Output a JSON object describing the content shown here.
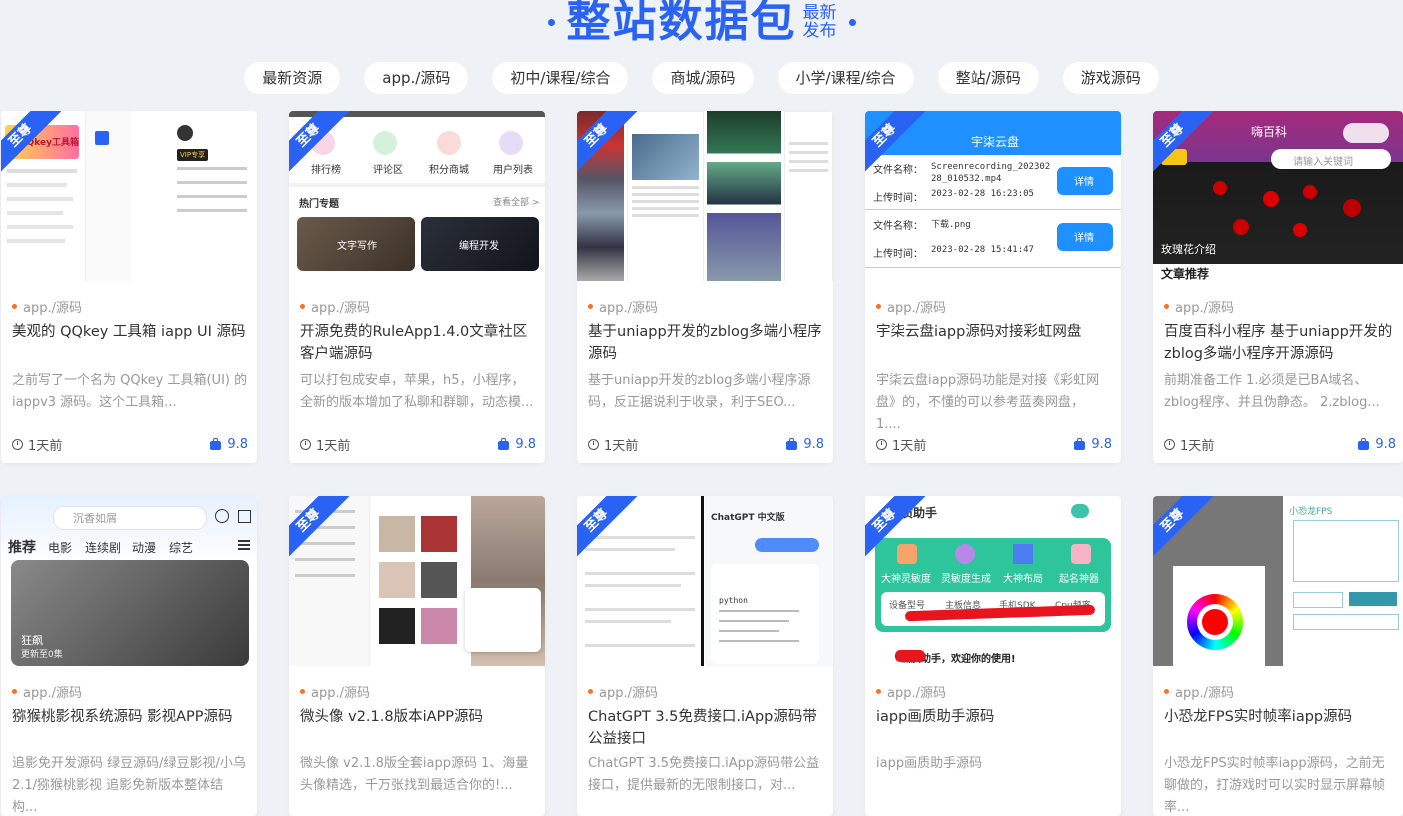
{
  "header": {
    "title": "整站数据包",
    "subtitle_1": "最新",
    "subtitle_2": "发布",
    "accent": "#2a63f3"
  },
  "tabs": [
    "最新资源",
    "app./源码",
    "初中/课程/综合",
    "商城/源码",
    "小学/课程/综合",
    "整站/源码",
    "游戏源码"
  ],
  "badge_label": "至尊",
  "cards": [
    {
      "category": "app./源码",
      "title": "美观的 QQkey 工具箱 iapp UI 源码",
      "desc": "之前写了一个名为 QQkey 工具箱(UI) 的 iappv3 源码。这个工具箱...",
      "time": "1天前",
      "score": "9.8"
    },
    {
      "category": "app./源码",
      "title": "开源免费的RuleApp1.4.0文章社区客户端源码",
      "desc": "可以打包成安卓，苹果，h5，小程序，全新的版本增加了私聊和群聊，动态模...",
      "time": "1天前",
      "score": "9.8"
    },
    {
      "category": "app./源码",
      "title": "基于uniapp开发的zblog多端小程序源码",
      "desc": "基于uniapp开发的zblog多端小程序源码，反正据说利于收录，利于SEO...",
      "time": "1天前",
      "score": "9.8"
    },
    {
      "category": "app./源码",
      "title": "宇柒云盘iapp源码对接彩虹网盘",
      "desc": "宇柒云盘iapp源码功能是对接《彩虹网盘》的，不懂的可以参考蓝奏网盘， 1....",
      "time": "1天前",
      "score": "9.8"
    },
    {
      "category": "app./源码",
      "title": "百度百科小程序 基于uniapp开发的zblog多端小程序开源源码",
      "desc": "前期准备工作 1.必须是已BA域名、zblog程序、并且伪静态。 2.zblog...",
      "time": "1天前",
      "score": "9.8"
    },
    {
      "category": "app./源码",
      "title": "猕猴桃影视系统源码 影视APP源码",
      "desc": "追影免开发源码 绿豆源码/绿豆影视/小乌2.1/猕猴桃影视 追影免新版本整体结构...",
      "time": "",
      "score": ""
    },
    {
      "category": "app./源码",
      "title": "微头像 v2.1.8版本iAPP源码",
      "desc": "微头像 v2.1.8版全套iapp源码 1、海量头像精选，千万张找到最适合你的!...",
      "time": "",
      "score": ""
    },
    {
      "category": "app./源码",
      "title": "ChatGPT 3.5免费接口.iApp源码带公益接口",
      "desc": "ChatGPT 3.5免费接口.iApp源码带公益接口，提供最新的无限制接口，对...",
      "time": "",
      "score": ""
    },
    {
      "category": "app./源码",
      "title": "iapp画质助手源码",
      "desc": "iapp画质助手源码",
      "time": "",
      "score": ""
    },
    {
      "category": "app./源码",
      "title": "小恐龙FPS实时帧率iapp源码",
      "desc": "小恐龙FPS实时帧率iapp源码，之前无聊做的，打游戏时可以实时显示屏幕帧率...",
      "time": "",
      "score": ""
    }
  ],
  "mock": {
    "c1_text": "QQkey工具箱",
    "c1_vip": "VIP专享",
    "c2_icons": [
      "排行榜",
      "评论区",
      "积分商城",
      "用户列表"
    ],
    "c2_section": "热门专题",
    "c2_more": "查看全部 >",
    "c2_tile1": "文字写作",
    "c2_tile2": "编程开发",
    "c4_app": "宇柒云盘",
    "c4_l1": "文件名称：",
    "c4_v1": "Screenrecording_20230228_010532.mp4",
    "c4_l2": "上传时间：",
    "c4_v2": "2023-02-28 16:23:05",
    "c4_v3": "下载.png",
    "c4_v4": "2023-02-28 15:41:47",
    "c4_btn": "详情",
    "c5_app": "嗨百科",
    "c5_search": "请输入关键词",
    "c5_caption": "玫瑰花介绍",
    "c5_section": "文章推荐",
    "c6_search": "沉香如屑",
    "c6_tabs": [
      "推荐",
      "电影",
      "连续剧",
      "动漫",
      "综艺"
    ],
    "c6_movie": "狂飙",
    "c6_update": "更新至0集",
    "c8_header": "ChatGPT 中文版",
    "c8_code": "python",
    "c9_title": "画质助手",
    "c9_items": [
      "大神灵敏度",
      "灵敏度生成",
      "大神布局",
      "起名神器"
    ],
    "c9_tabs": [
      "设备型号",
      "主板信息",
      "手机SDK",
      "Cpu频率"
    ],
    "c9_welcome": "画质助手，欢迎你的使用!",
    "c10_title": "小恐龙FPS"
  }
}
